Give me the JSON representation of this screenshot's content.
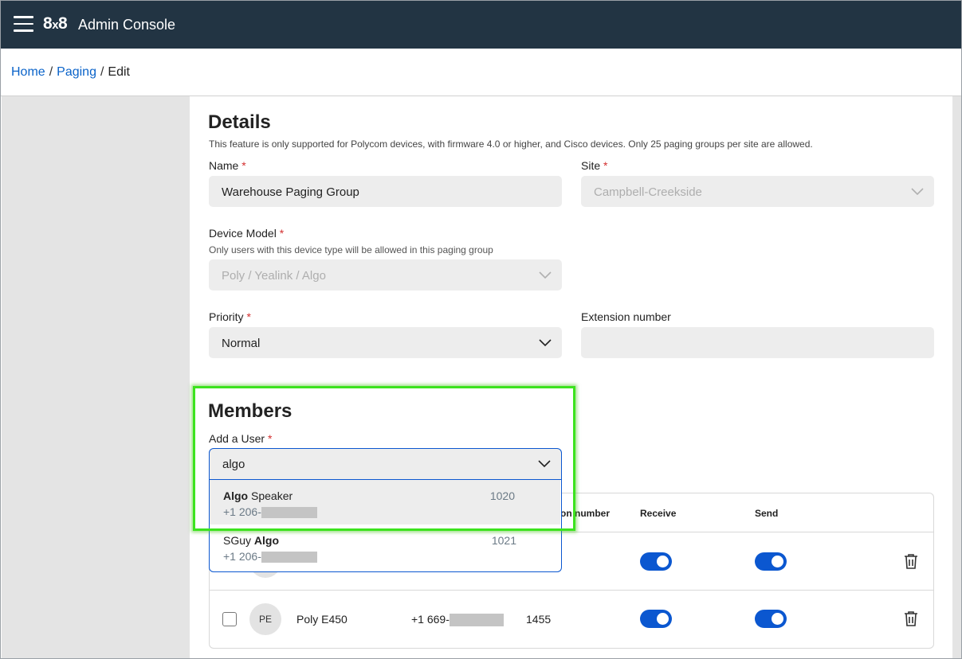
{
  "header": {
    "logo_main": "8",
    "logo_x": "x",
    "logo_tail": "8",
    "title": "Admin Console"
  },
  "breadcrumb": {
    "home": "Home",
    "sep1": "/",
    "paging": "Paging",
    "sep2": "/",
    "current": "Edit"
  },
  "details": {
    "heading": "Details",
    "description": "This feature is only supported for Polycom devices, with firmware 4.0 or higher, and Cisco devices. Only 25 paging groups per site are allowed.",
    "name_label": "Name",
    "name_value": "Warehouse Paging Group",
    "site_label": "Site",
    "site_value": "Campbell-Creekside",
    "device_label": "Device Model",
    "device_help": "Only users with this device type will be allowed in this paging group",
    "device_value": "Poly / Yealink / Algo",
    "priority_label": "Priority",
    "priority_value": "Normal",
    "ext_label": "Extension number",
    "ext_value": "",
    "required_mark": "*"
  },
  "members": {
    "heading": "Members",
    "add_user_label": "Add a User",
    "search_value": "algo",
    "options": [
      {
        "bold": "Algo",
        "rest": " Speaker",
        "phone_prefix": "+1 206-",
        "ext": "1020"
      },
      {
        "prefix": "SGuy ",
        "bold": "Algo",
        "phone_prefix": "+1 206-",
        "ext": "1021"
      }
    ]
  },
  "table": {
    "col_ext_partial": "on number",
    "col_receive": "Receive",
    "col_send": "Send",
    "rows": [
      {
        "initials": "PE",
        "name": "Poly E450",
        "phone_prefix": "+1 669-",
        "ext": "1455",
        "receive": true,
        "send": true
      }
    ]
  },
  "colors": {
    "topbar": "#223443",
    "accent": "#0b57d0",
    "link": "#0a63c9",
    "highlight": "#3ce31e"
  },
  "icons": [
    "menu-icon",
    "chevron-down-icon",
    "trash-icon",
    "checkbox-icon"
  ]
}
